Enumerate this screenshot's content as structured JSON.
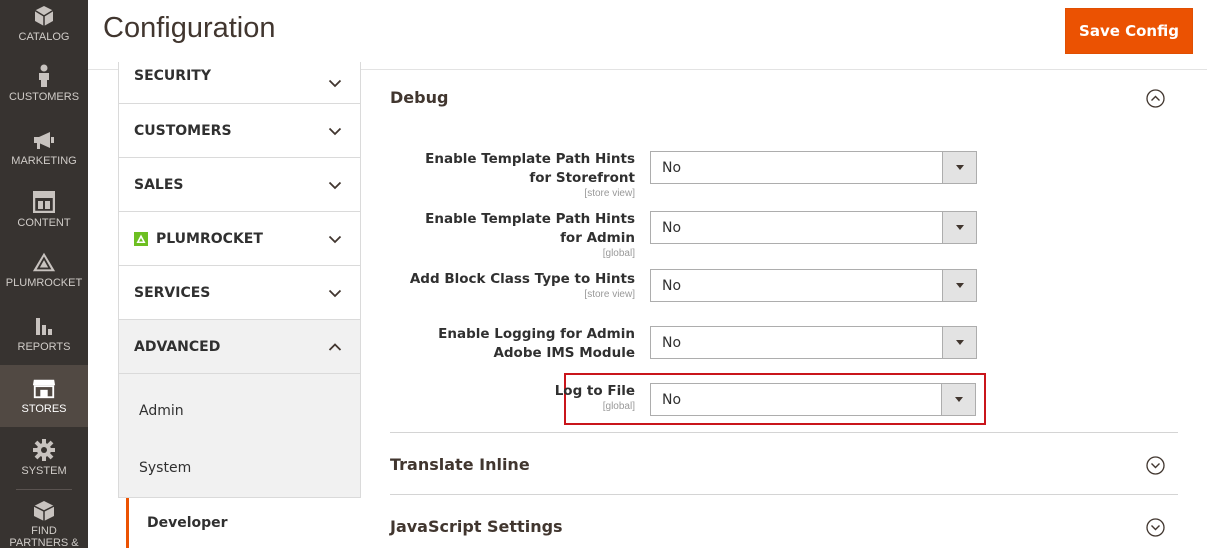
{
  "nav": {
    "items": [
      {
        "label": "CATALOG",
        "icon": "cube-icon"
      },
      {
        "label": "CUSTOMERS",
        "icon": "person-icon"
      },
      {
        "label": "MARKETING",
        "icon": "megaphone-icon"
      },
      {
        "label": "CONTENT",
        "icon": "layout-icon"
      },
      {
        "label": "PLUMROCKET",
        "icon": "plumrocket-icon"
      },
      {
        "label": "REPORTS",
        "icon": "bar-chart-icon"
      },
      {
        "label": "STORES",
        "icon": "store-icon"
      },
      {
        "label": "SYSTEM",
        "icon": "gear-icon"
      },
      {
        "label": "FIND PARTNERS & EXTENSIONS",
        "icon": "boxes-icon"
      }
    ]
  },
  "header": {
    "title": "Configuration",
    "save_label": "Save Config"
  },
  "tabs": {
    "security": "SECURITY",
    "customers": "CUSTOMERS",
    "sales": "SALES",
    "plumrocket": "PLUMROCKET",
    "services": "SERVICES",
    "advanced": "ADVANCED",
    "sub": {
      "admin": "Admin",
      "system": "System",
      "developer": "Developer"
    }
  },
  "main": {
    "debug": {
      "title": "Debug",
      "fields": [
        {
          "label": "Enable Template Path Hints for Storefront",
          "scope": "[store view]",
          "value": "No"
        },
        {
          "label": "Enable Template Path Hints for Admin",
          "scope": "[global]",
          "value": "No"
        },
        {
          "label": "Add Block Class Type to Hints",
          "scope": "[store view]",
          "value": "No"
        },
        {
          "label": "Enable Logging for Admin Adobe IMS Module",
          "scope": "",
          "value": "No"
        },
        {
          "label": "Log to File",
          "scope": "[global]",
          "value": "No"
        }
      ]
    },
    "translate_inline": {
      "title": "Translate Inline"
    },
    "javascript_settings": {
      "title": "JavaScript Settings"
    }
  },
  "colors": {
    "accent": "#eb5202",
    "highlight": "#c9151b",
    "nav_bg": "#373330"
  }
}
